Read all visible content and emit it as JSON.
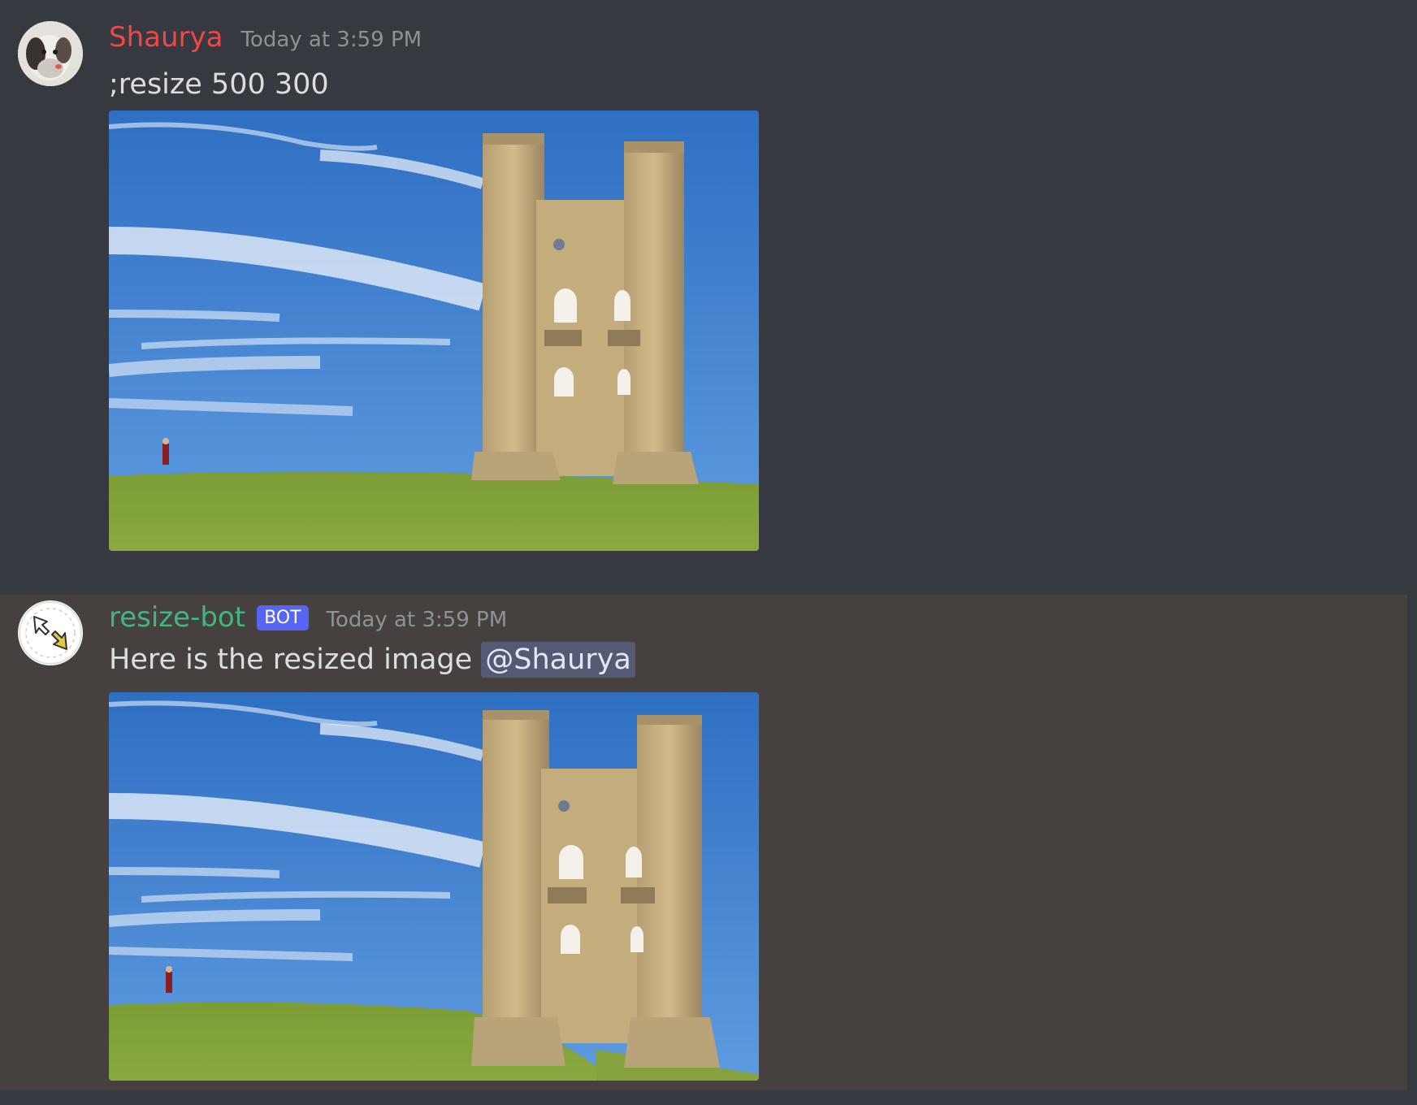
{
  "messages": [
    {
      "author": "Shaurya",
      "timestamp": "Today at 3:59 PM",
      "text": ";resize 500 300",
      "author_color": "#f04747"
    },
    {
      "author": "resize-bot",
      "badge": "BOT",
      "timestamp": "Today at 3:59 PM",
      "text": "Here is the resized image ",
      "mention": "@Shaurya",
      "author_color": "#43b581"
    }
  ],
  "colors": {
    "background": "#36393f",
    "highlight_background": "#46413e",
    "badge": "#5865f2"
  },
  "icons": {
    "user_avatar": "dog-photo-avatar",
    "bot_avatar": "resize-arrows-icon"
  }
}
